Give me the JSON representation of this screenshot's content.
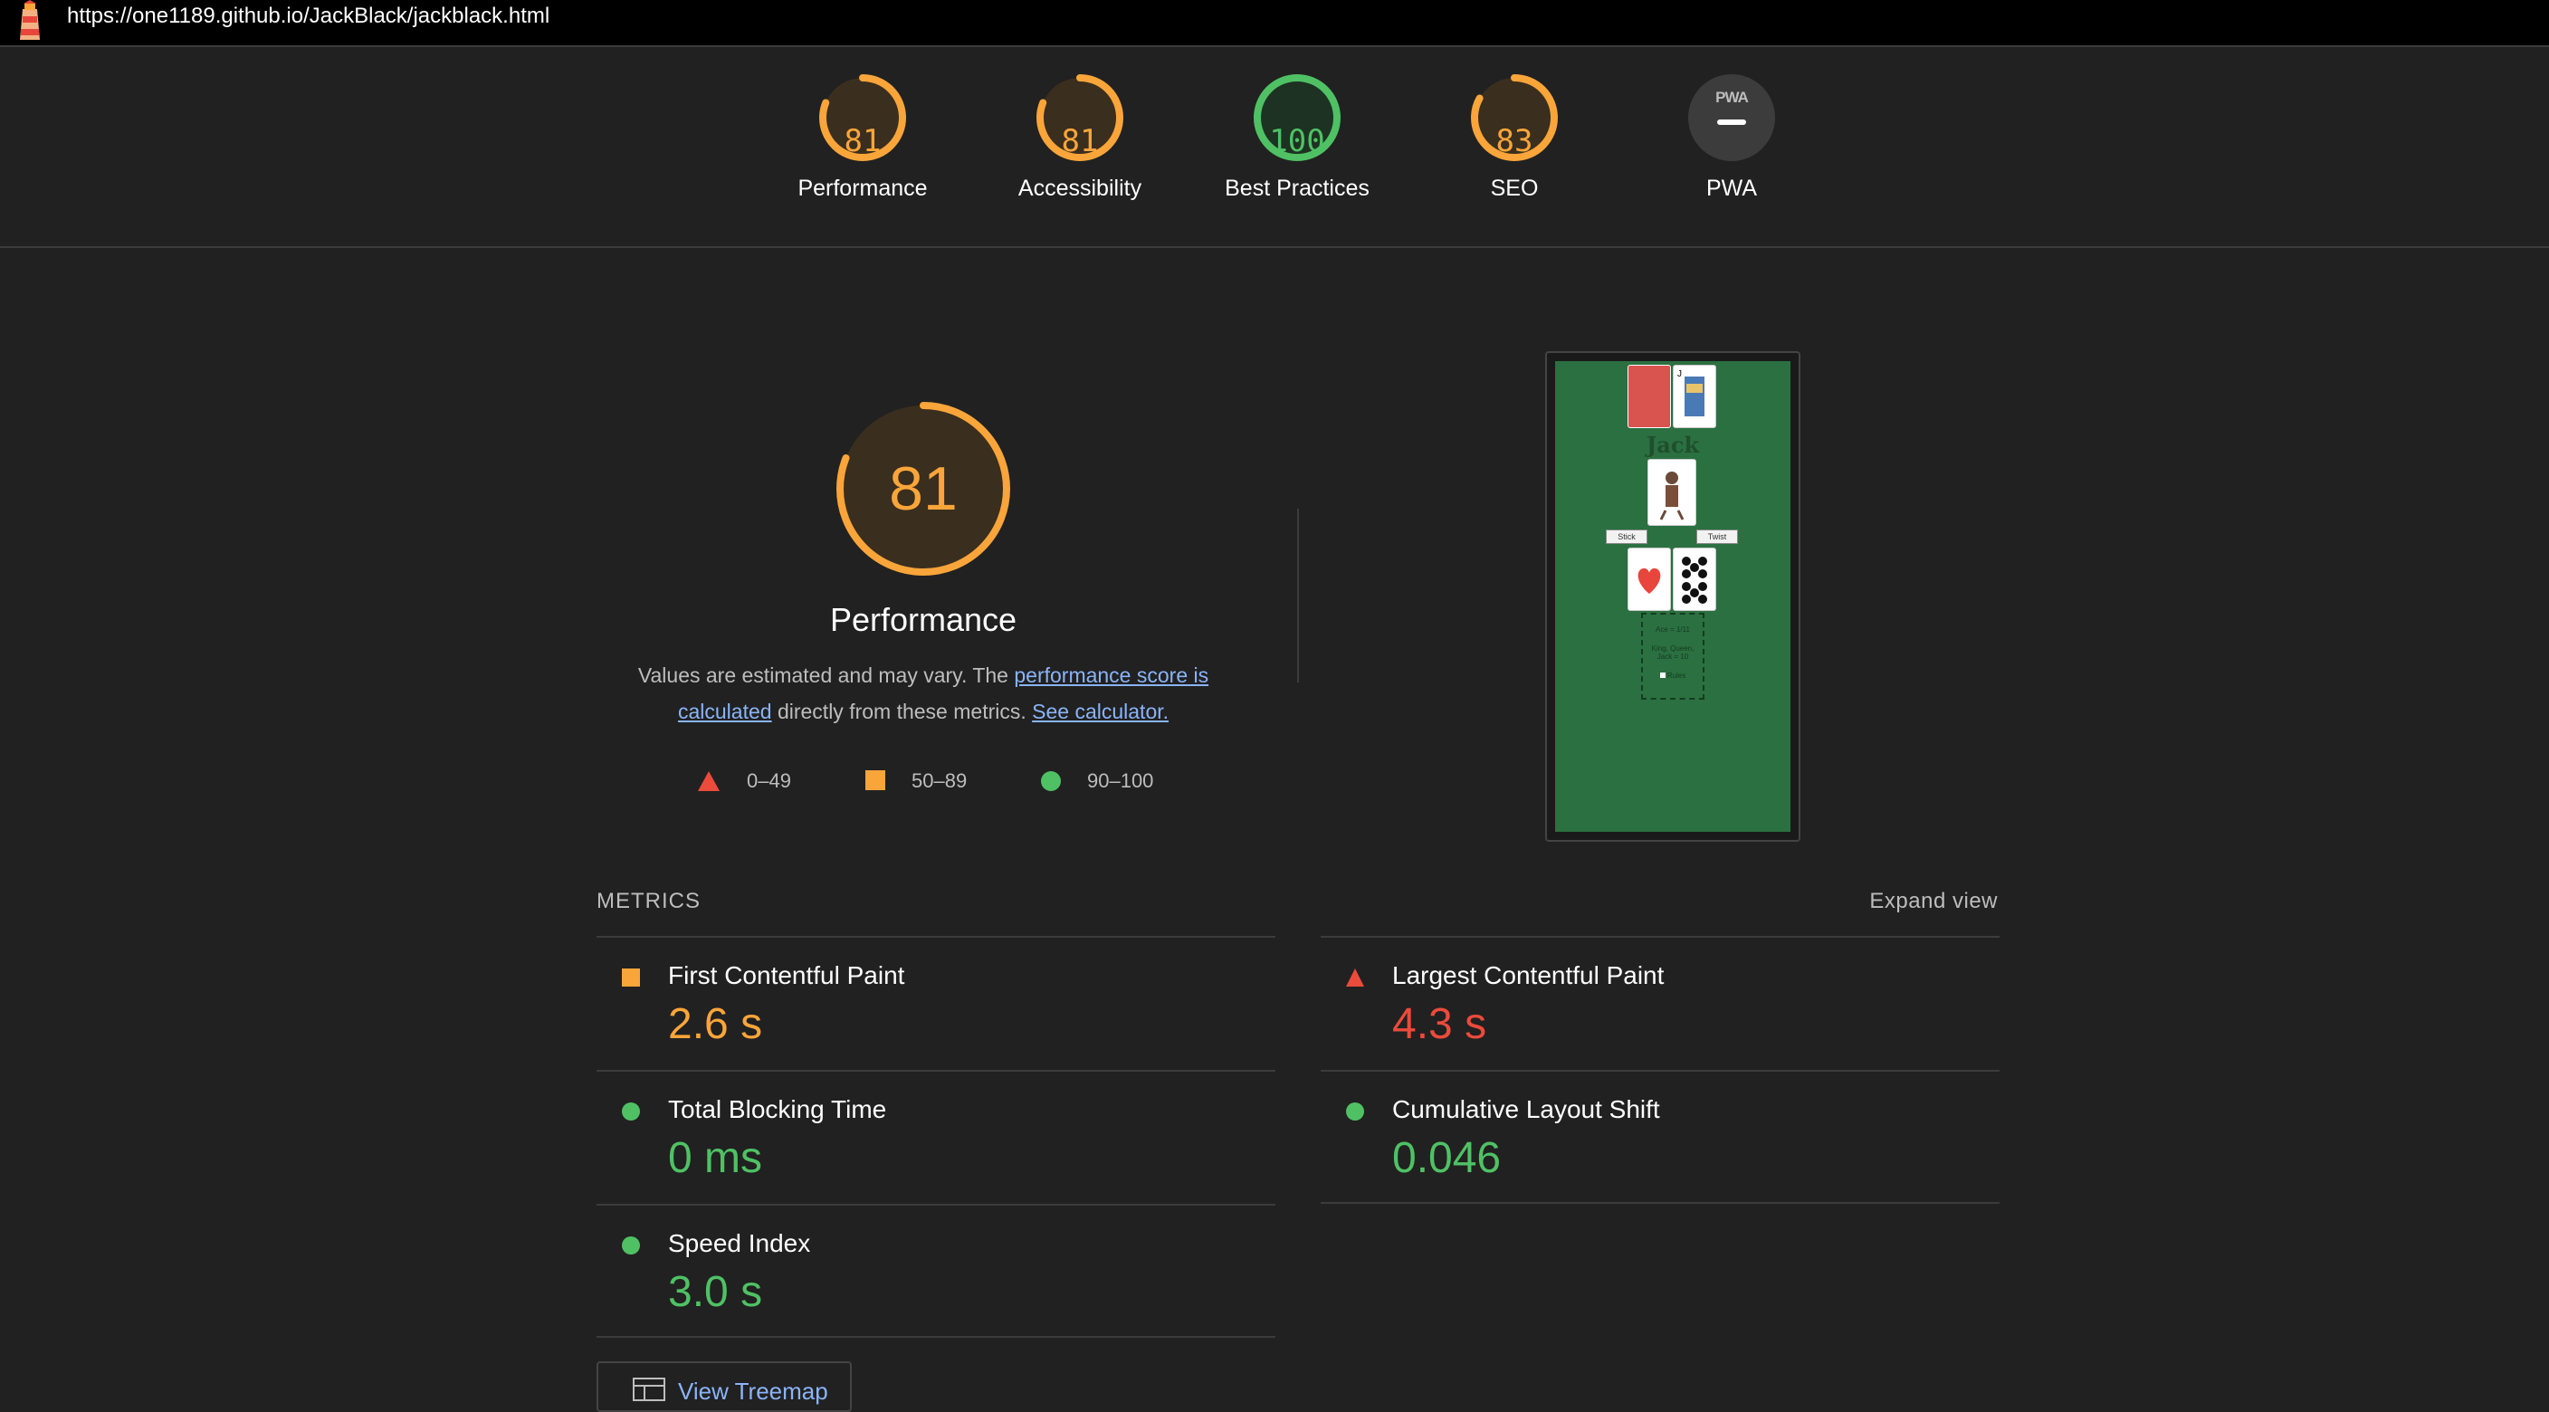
{
  "browser": {
    "url": "https://one1189.github.io/JackBlack/jackblack.html",
    "logo_icon": "lighthouse-icon"
  },
  "gauges": [
    {
      "score": "81",
      "label": "Performance",
      "value": 81,
      "color": "#f9a53a"
    },
    {
      "score": "81",
      "label": "Accessibility",
      "value": 81,
      "color": "#f9a53a"
    },
    {
      "score": "100",
      "label": "Best Practices",
      "value": 100,
      "color": "#4fc164"
    },
    {
      "score": "83",
      "label": "SEO",
      "value": 83,
      "color": "#f9a53a"
    }
  ],
  "pwa": {
    "badge_text": "PWA",
    "label": "PWA"
  },
  "performance": {
    "score": "81",
    "value": 81,
    "title": "Performance",
    "desc_prefix": "Values are estimated and may vary. The ",
    "link_score": "performance score is calculated",
    "desc_middle": " directly from these metrics. ",
    "link_calculator": "See calculator."
  },
  "legend": [
    {
      "shape": "triangle",
      "range": "0–49",
      "color": "#eb4b3b"
    },
    {
      "shape": "square",
      "range": "50–89",
      "color": "#f9a53a"
    },
    {
      "shape": "circle",
      "range": "90–100",
      "color": "#4fc164"
    }
  ],
  "screenshot": {
    "title": "Jack",
    "stick_label": "Stick",
    "twist_label": "Twist",
    "rules_lines": [
      "Ace = 1/11",
      "King, Queen,",
      "Jack = 10"
    ],
    "checkbox_label": "Rules"
  },
  "metrics": {
    "header": "METRICS",
    "expand": "Expand view",
    "items": [
      {
        "name": "First Contentful Paint",
        "value": "2.6 s",
        "status": "square",
        "color": "#f9a53a"
      },
      {
        "name": "Largest Contentful Paint",
        "value": "4.3 s",
        "status": "triangle",
        "color": "#eb4b3b"
      },
      {
        "name": "Total Blocking Time",
        "value": "0 ms",
        "status": "circle",
        "color": "#4fc164"
      },
      {
        "name": "Cumulative Layout Shift",
        "value": "0.046",
        "status": "circle",
        "color": "#4fc164"
      },
      {
        "name": "Speed Index",
        "value": "3.0 s",
        "status": "circle",
        "color": "#4fc164"
      }
    ]
  },
  "treemap": {
    "label": "View Treemap",
    "icon": "treemap-icon"
  }
}
